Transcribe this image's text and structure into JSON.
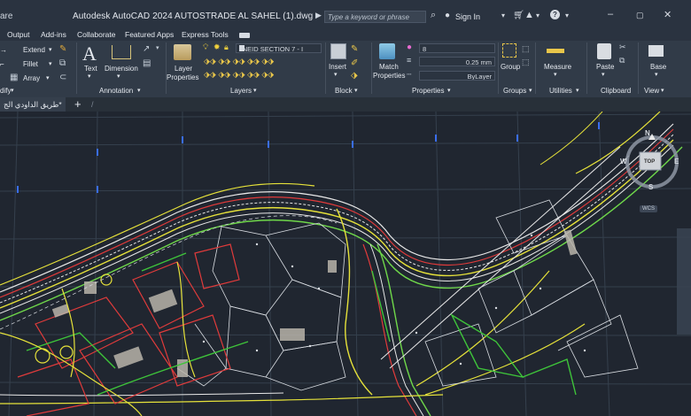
{
  "titlebar": {
    "app_edge_text": "are",
    "title": "Autodesk AutoCAD 2024   AUTOSTRADE AL SAHEL (1).dwg",
    "search_placeholder": "Type a keyword or phrase",
    "signin": "Sign In"
  },
  "menu": {
    "items": [
      "Output",
      "Add-ins",
      "Collaborate",
      "Featured Apps",
      "Express Tools"
    ]
  },
  "ribbon": {
    "modify": {
      "extend": "Extend",
      "fillet": "Fillet",
      "array": "Array",
      "panel": "dify"
    },
    "annotation": {
      "text": "Text",
      "dimension": "Dimension",
      "panel": "Annotation"
    },
    "layers": {
      "layer_properties_1": "Layer",
      "layer_properties_2": "Properties",
      "current_layer": "JNEID SECTION 7 - I",
      "panel": "Layers"
    },
    "block": {
      "insert": "Insert",
      "panel": "Block"
    },
    "properties": {
      "match_1": "Match",
      "match_2": "Properties",
      "color": "8",
      "lineweight": "0.25 mm",
      "linetype": "ByLayer",
      "panel": "Properties"
    },
    "groups": {
      "group": "Group",
      "panel": "Groups"
    },
    "utilities": {
      "measure": "Measure",
      "panel": "Utilities"
    },
    "clipboard": {
      "paste": "Paste",
      "panel": "Clipboard"
    },
    "view": {
      "base": "Base",
      "panel": "View"
    }
  },
  "file_tab": {
    "label": "طريق الداودي الج*"
  },
  "viewcube": {
    "n": "N",
    "s": "S",
    "e": "E",
    "w": "W",
    "top": "TOP",
    "wcs": "WCS"
  }
}
